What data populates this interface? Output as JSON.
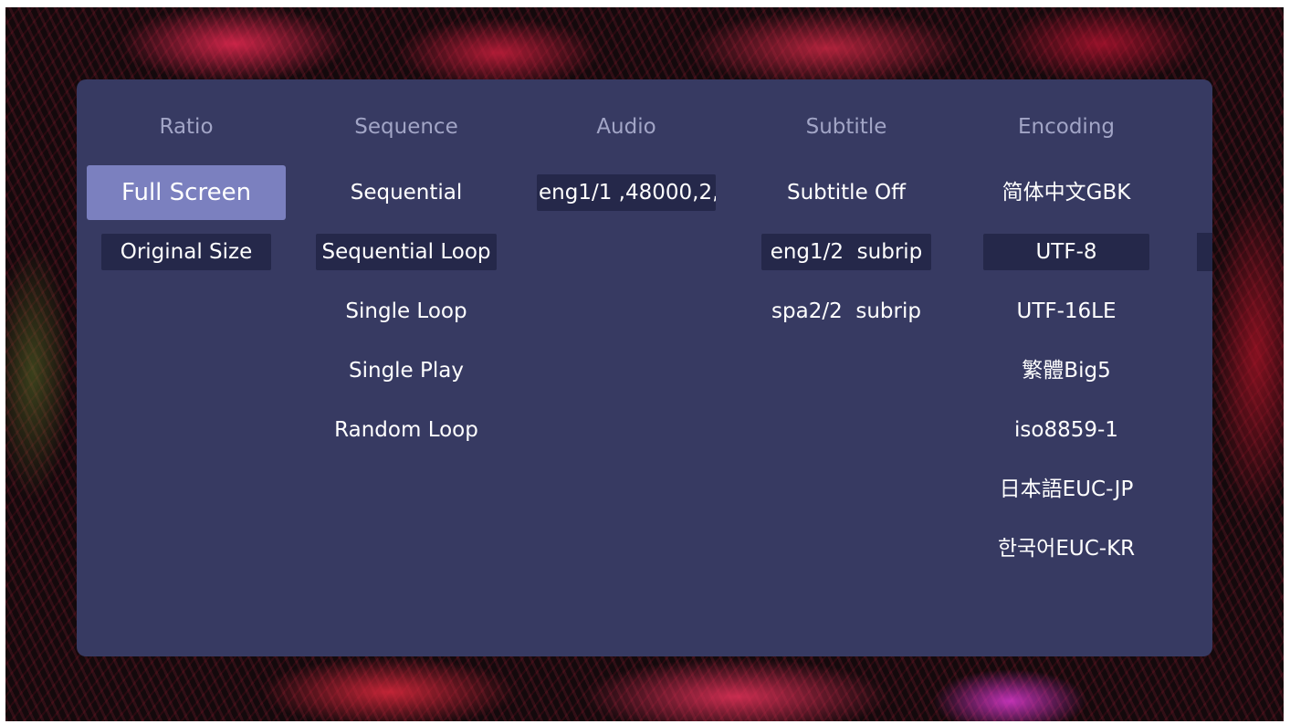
{
  "columns": {
    "ratio": {
      "header": "Ratio",
      "items": [
        "Full Screen",
        "Original Size"
      ],
      "focused": "Full Screen",
      "selected": "Original Size"
    },
    "sequence": {
      "header": "Sequence",
      "items": [
        "Sequential",
        "Sequential Loop",
        "Single Loop",
        "Single Play",
        "Random Loop"
      ],
      "selected": "Sequential Loop"
    },
    "audio": {
      "header": "Audio",
      "items": [
        "eng1/1 ,48000,2,"
      ],
      "selected": "eng1/1 ,48000,2,"
    },
    "subtitle": {
      "header": "Subtitle",
      "items": [
        "Subtitle Off",
        "eng1/2  subrip",
        "spa2/2  subrip"
      ],
      "selected": "eng1/2  subrip"
    },
    "encoding": {
      "header": "Encoding",
      "items": [
        "简体中文GBK",
        "UTF-8",
        "UTF-16LE",
        "繁體Big5",
        "iso8859-1",
        "日本語EUC-JP",
        "한국어EUC-KR"
      ],
      "selected": "UTF-8"
    }
  },
  "colors": {
    "panel": "#373a62",
    "header_text": "#a2a5c6",
    "item_text": "#ffffff",
    "selected_bg": "#25284a",
    "focused_bg": "#7b80bf"
  }
}
